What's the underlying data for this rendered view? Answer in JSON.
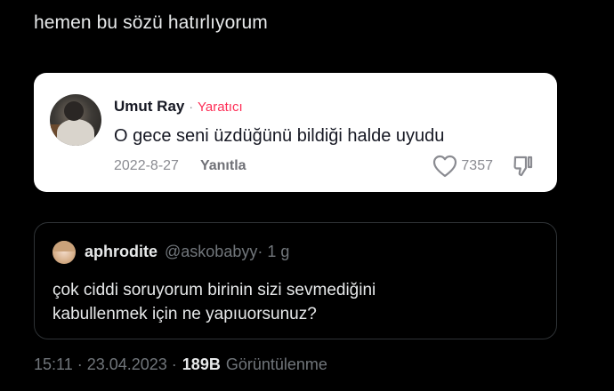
{
  "tweet": {
    "text": "hemen bu sözü hatırlıyorum"
  },
  "comment": {
    "author": "Umut Ray",
    "separator": "·",
    "creator_label": "Yaratıcı",
    "text": "O gece seni üzdüğünü bildiği halde uyudu",
    "date": "2022-8-27",
    "reply_label": "Yanıtla",
    "like_count": "7357",
    "accent_color": "#fe2c55"
  },
  "quote": {
    "name": "aphrodite",
    "handle": "@askobabyy",
    "time": "· 1 g",
    "line1": "çok ciddi soruyorum birinin sizi sevmediğini",
    "line2": "kabullenmek için ne yapıuorsunuz?"
  },
  "meta": {
    "timestamp": "15:11 · 23.04.2023 ·",
    "views_count": "189B",
    "views_label": "Görüntülenme"
  }
}
